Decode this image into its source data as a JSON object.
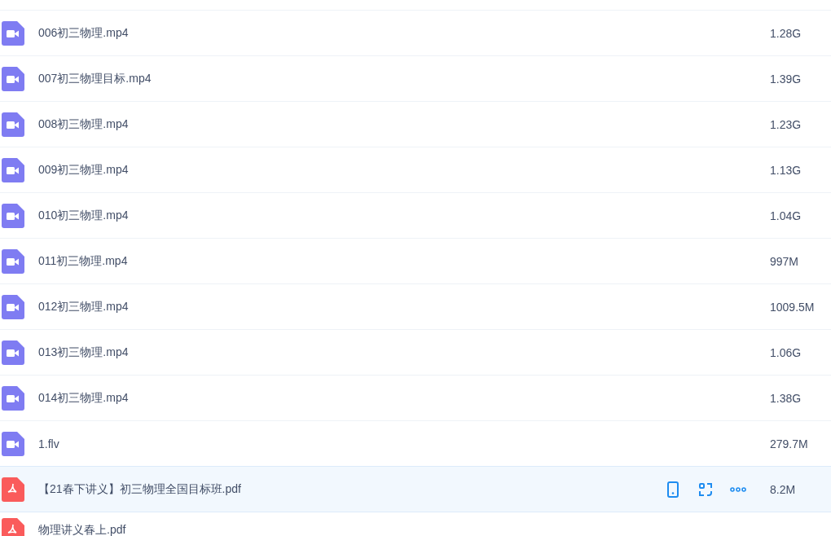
{
  "files": [
    {
      "kind": "video",
      "name": "006初三物理.mp4",
      "size": "1.28G",
      "selected": false
    },
    {
      "kind": "video",
      "name": "007初三物理目标.mp4",
      "size": "1.39G",
      "selected": false
    },
    {
      "kind": "video",
      "name": "008初三物理.mp4",
      "size": "1.23G",
      "selected": false
    },
    {
      "kind": "video",
      "name": "009初三物理.mp4",
      "size": "1.13G",
      "selected": false
    },
    {
      "kind": "video",
      "name": "010初三物理.mp4",
      "size": "1.04G",
      "selected": false
    },
    {
      "kind": "video",
      "name": "011初三物理.mp4",
      "size": "997M",
      "selected": false
    },
    {
      "kind": "video",
      "name": "012初三物理.mp4",
      "size": "1009.5M",
      "selected": false
    },
    {
      "kind": "video",
      "name": "013初三物理.mp4",
      "size": "1.06G",
      "selected": false
    },
    {
      "kind": "video",
      "name": "014初三物理.mp4",
      "size": "1.38G",
      "selected": false
    },
    {
      "kind": "video",
      "name": "1.flv",
      "size": "279.7M",
      "selected": false
    },
    {
      "kind": "pdf",
      "name": "【21春下讲义】初三物理全国目标班.pdf",
      "size": "8.2M",
      "selected": true
    },
    {
      "kind": "pdf",
      "name": "物理讲义春上.pdf",
      "selected": false
    }
  ]
}
